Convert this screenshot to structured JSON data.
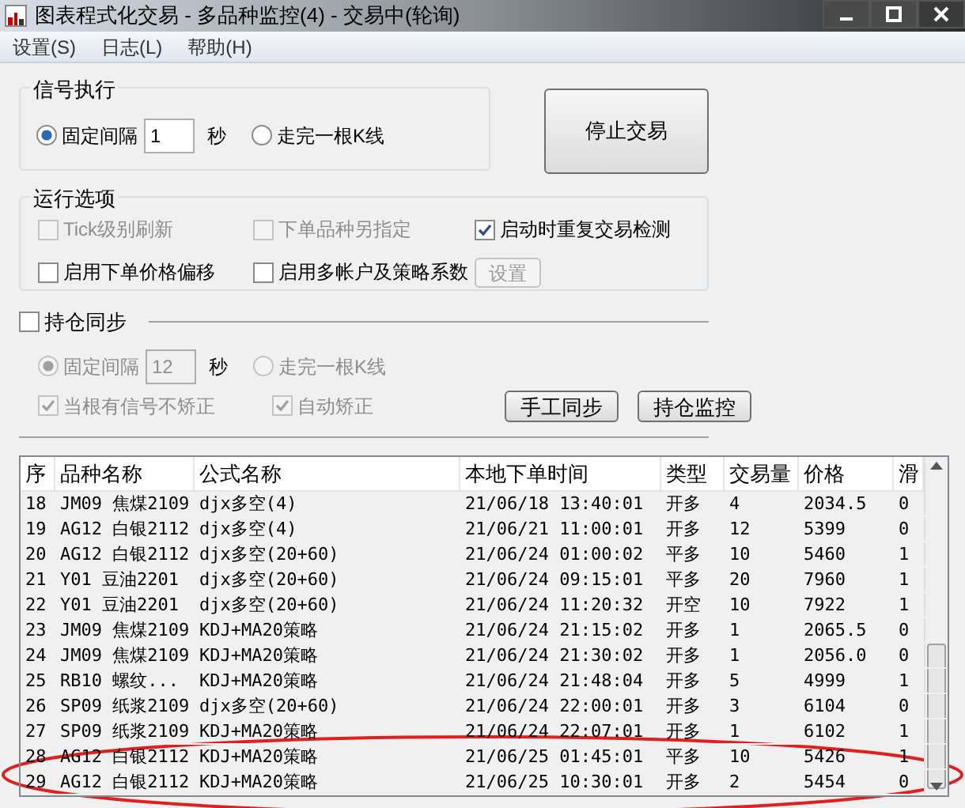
{
  "window": {
    "title": "图表程式化交易 - 多品种监控(4) - 交易中(轮询)"
  },
  "menu": [
    "设置(S)",
    "日志(L)",
    "帮助(H)"
  ],
  "signal_group": {
    "title": "信号执行",
    "options": [
      {
        "label": "固定间隔",
        "selected": true
      },
      {
        "label": "走完一根K线",
        "selected": false
      }
    ],
    "interval": "1",
    "unit": "秒"
  },
  "stop_button": "停止交易",
  "run_options": {
    "title": "运行选项",
    "items": [
      {
        "label": "Tick级别刷新",
        "checked": false,
        "disabled": true
      },
      {
        "label": "下单品种另指定",
        "checked": false,
        "disabled": true
      },
      {
        "label": "启动时重复交易检测",
        "checked": true,
        "disabled": false
      },
      {
        "label": "启用下单价格偏移",
        "checked": false,
        "disabled": false
      },
      {
        "label": "启用多帐户及策略系数",
        "checked": false,
        "disabled": false
      }
    ],
    "settings_button": {
      "label": "设置",
      "disabled": true
    }
  },
  "position_sync": {
    "label": "持仓同步",
    "checked": false,
    "options": [
      {
        "label": "固定间隔",
        "selected": true,
        "disabled": true
      },
      {
        "label": "走完一根K线",
        "selected": false,
        "disabled": true
      }
    ],
    "interval": "12",
    "unit": "秒",
    "checks": [
      {
        "label": "当根有信号不矫正",
        "checked": true,
        "disabled": true
      },
      {
        "label": "自动矫正",
        "checked": true,
        "disabled": true
      }
    ],
    "buttons": [
      "手工同步",
      "持仓监控"
    ]
  },
  "table": {
    "columns": [
      "序",
      "品种名称",
      "公式名称",
      "本地下单时间",
      "类型",
      "交易量",
      "价格",
      "滑"
    ],
    "rows": [
      [
        "18",
        "JM09 焦煤2109",
        "djx多空(4)",
        "21/06/18 13:40:01",
        "开多",
        "4",
        "2034.5",
        "0"
      ],
      [
        "19",
        "AG12 白银2112",
        "djx多空(4)",
        "21/06/21 11:00:01",
        "开多",
        "12",
        "5399",
        "0"
      ],
      [
        "20",
        "AG12 白银2112",
        "djx多空(20+60)",
        "21/06/24 01:00:02",
        "平多",
        "10",
        "5460",
        "1"
      ],
      [
        "21",
        "Y01 豆油2201",
        "djx多空(20+60)",
        "21/06/24 09:15:01",
        "平多",
        "20",
        "7960",
        "1"
      ],
      [
        "22",
        "Y01 豆油2201",
        "djx多空(20+60)",
        "21/06/24 11:20:32",
        "开空",
        "10",
        "7922",
        "1"
      ],
      [
        "23",
        "JM09 焦煤2109",
        "KDJ+MA20策略",
        "21/06/24 21:15:02",
        "开多",
        "1",
        "2065.5",
        "0"
      ],
      [
        "24",
        "JM09 焦煤2109",
        "KDJ+MA20策略",
        "21/06/24 21:30:02",
        "开多",
        "1",
        "2056.0",
        "0"
      ],
      [
        "25",
        "RB10 螺纹...",
        "KDJ+MA20策略",
        "21/06/24 21:48:04",
        "开多",
        "5",
        "4999",
        "1"
      ],
      [
        "26",
        "SP09 纸浆2109",
        "djx多空(20+60)",
        "21/06/24 22:00:01",
        "开多",
        "3",
        "6104",
        "0"
      ],
      [
        "27",
        "SP09 纸浆2109",
        "KDJ+MA20策略",
        "21/06/24 22:07:01",
        "开多",
        "1",
        "6102",
        "1"
      ],
      [
        "28",
        "AG12 白银2112",
        "KDJ+MA20策略",
        "21/06/25 01:45:01",
        "平多",
        "10",
        "5426",
        "1"
      ],
      [
        "29",
        "AG12 白银2112",
        "KDJ+MA20策略",
        "21/06/25 10:30:01",
        "开多",
        "2",
        "5454",
        "0"
      ]
    ]
  }
}
